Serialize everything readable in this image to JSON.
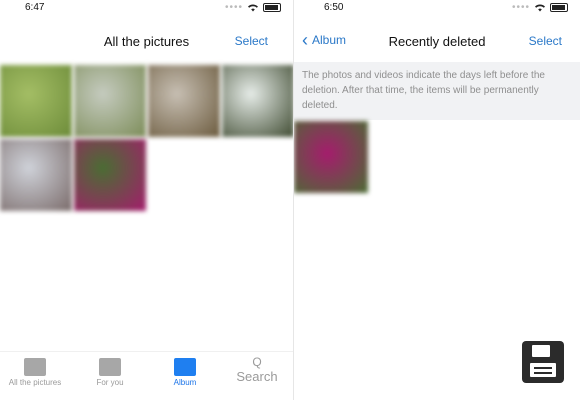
{
  "left_screen": {
    "status_time": "6:47",
    "nav": {
      "title": "All the pictures",
      "select_label": "Select"
    },
    "thumbnails": [
      {
        "icon": "photo-leaf",
        "colors": [
          "#6c8b39",
          "#a4be65"
        ]
      },
      {
        "icon": "photo-mountain",
        "colors": [
          "#7c8c58",
          "#c5cbbf"
        ]
      },
      {
        "icon": "photo-canyon",
        "colors": [
          "#6b5a3d",
          "#c7bfb3"
        ]
      },
      {
        "icon": "photo-waterfall",
        "colors": [
          "#3f4b31",
          "#e6ece8"
        ]
      },
      {
        "icon": "photo-waterfall-2",
        "colors": [
          "#7a6b6a",
          "#cfd2d9"
        ]
      },
      {
        "icon": "photo-flower",
        "colors": [
          "#a51c6d",
          "#4a6d33"
        ]
      }
    ],
    "tabs": [
      {
        "label": "All the pictures",
        "icon": "photos-icon",
        "active": false
      },
      {
        "label": "For you",
        "icon": "for-you-icon",
        "active": false
      },
      {
        "label": "Album",
        "icon": "album-icon",
        "active": true
      }
    ],
    "search": {
      "glyph": "Q",
      "label": "Search"
    }
  },
  "right_screen": {
    "status_time": "6:50",
    "nav": {
      "back_label": "Album",
      "title": "Recently deleted",
      "select_label": "Select"
    },
    "notice": "The photos and videos indicate the days left before the deletion. After that time, the items will be permanently deleted.",
    "thumbnail": {
      "icon": "photo-flower",
      "colors": [
        "#a51c6d",
        "#4a6d33"
      ]
    }
  },
  "overlay": {
    "icon": "save-icon"
  }
}
